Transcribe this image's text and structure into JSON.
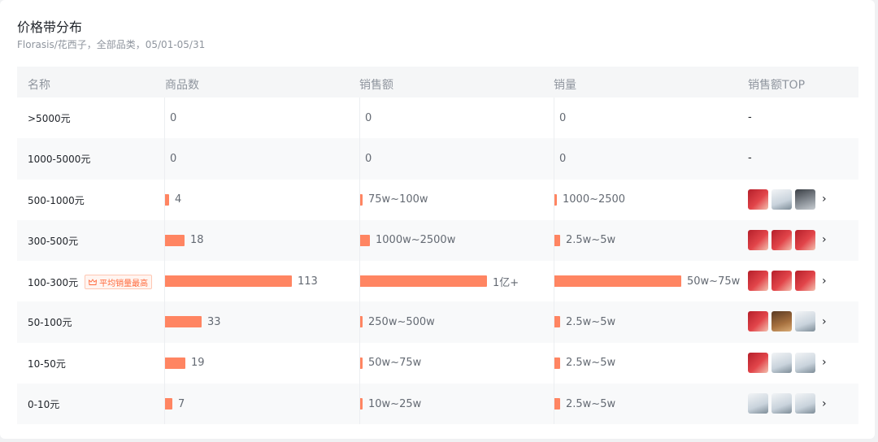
{
  "header": {
    "title": "价格带分布",
    "subtitle": "Florasis/花西子，全部品类，05/01-05/31"
  },
  "columns": {
    "name": "名称",
    "count": "商品数",
    "sales_amount": "销售额",
    "sales_volume": "销量",
    "top": "销售额TOP"
  },
  "badge_label": "平均销量最高",
  "colors": {
    "bar": "#ff8562",
    "badge": "#ff6a3d"
  },
  "rows": [
    {
      "name": ">5000元",
      "count": "0",
      "count_value": 0,
      "amount": "0",
      "amount_level": 0,
      "volume": "0",
      "volume_level": 0,
      "top": "-",
      "thumbs": []
    },
    {
      "name": "1000-5000元",
      "count": "0",
      "count_value": 0,
      "amount": "0",
      "amount_level": 0,
      "volume": "0",
      "volume_level": 0,
      "top": "-",
      "thumbs": []
    },
    {
      "name": "500-1000元",
      "count": "4",
      "count_value": 4,
      "amount": "75w~100w",
      "amount_level": 0.02,
      "volume": "1000~2500",
      "volume_level": 0.005,
      "top": "",
      "thumbs": [
        "red",
        "white",
        "dark"
      ]
    },
    {
      "name": "300-500元",
      "count": "18",
      "count_value": 18,
      "amount": "1000w~2500w",
      "amount_level": 0.08,
      "volume": "2.5w~5w",
      "volume_level": 0.05,
      "top": "",
      "thumbs": [
        "red",
        "red",
        "red"
      ]
    },
    {
      "name": "100-300元",
      "count": "113",
      "count_value": 113,
      "amount": "1亿+",
      "amount_level": 1,
      "volume": "50w~75w",
      "volume_level": 1,
      "top": "",
      "thumbs": [
        "red",
        "red",
        "red"
      ],
      "badge": true
    },
    {
      "name": "50-100元",
      "count": "33",
      "count_value": 33,
      "amount": "250w~500w",
      "amount_level": 0.02,
      "volume": "2.5w~5w",
      "volume_level": 0.05,
      "top": "",
      "thumbs": [
        "red",
        "brown",
        "white"
      ]
    },
    {
      "name": "10-50元",
      "count": "19",
      "count_value": 19,
      "amount": "50w~75w",
      "amount_level": 0.01,
      "volume": "2.5w~5w",
      "volume_level": 0.05,
      "top": "",
      "thumbs": [
        "red",
        "white",
        "white"
      ]
    },
    {
      "name": "0-10元",
      "count": "7",
      "count_value": 7,
      "amount": "10w~25w",
      "amount_level": 0.01,
      "volume": "2.5w~5w",
      "volume_level": 0.05,
      "top": "",
      "thumbs": [
        "white",
        "white",
        "white"
      ]
    }
  ]
}
